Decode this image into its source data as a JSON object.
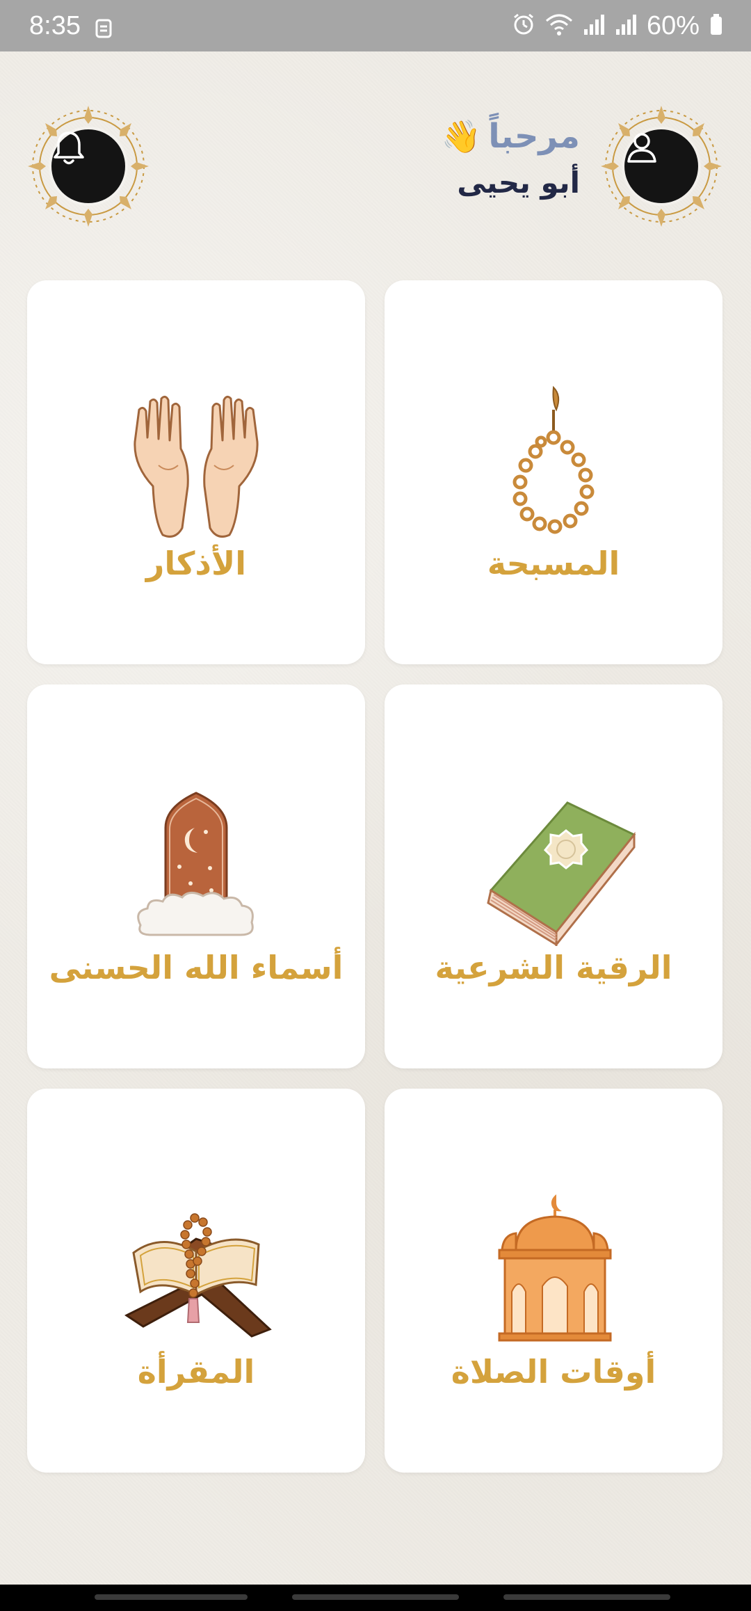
{
  "status_bar": {
    "time": "8:35",
    "battery": "60%",
    "icons": [
      "sim-icon",
      "alarm-icon",
      "wifi-icon",
      "signal-icon",
      "signal-icon-2",
      "battery-icon"
    ]
  },
  "header": {
    "greeting": "مرحباً",
    "greeting_emoji": "👋",
    "user_name": "أبو يحيى",
    "left_button_icon": "bell-icon",
    "right_button_icon": "user-icon"
  },
  "cards": [
    {
      "label": "المسبحة",
      "icon": "prayer-beads-icon"
    },
    {
      "label": "الأذكار",
      "icon": "praying-hands-icon"
    },
    {
      "label": "الرقية الشرعية",
      "icon": "book-icon"
    },
    {
      "label": "أسماء الله الحسنى",
      "icon": "crescent-moon-arch-icon"
    },
    {
      "label": "أوقات الصلاة",
      "icon": "mosque-icon"
    },
    {
      "label": "المقرأة",
      "icon": "quran-stand-icon"
    }
  ],
  "colors": {
    "accent_gold": "#d4a23c",
    "greeting_blue": "#7d90b6",
    "name_navy": "#222846",
    "status_bar": "#a6a6a6"
  }
}
